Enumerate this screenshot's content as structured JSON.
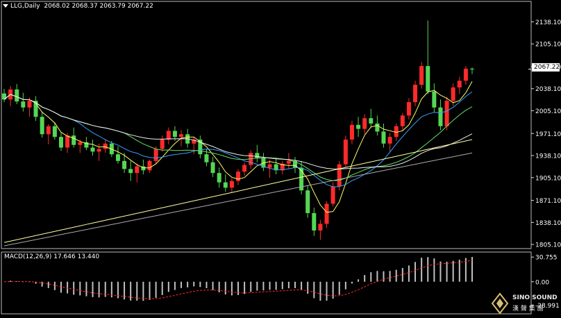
{
  "header": {
    "symbol_label": "LLG,Daily",
    "ohlc": "2068.02 2068.37 2063.79 2067.22"
  },
  "macd_header": {
    "label": "MACD(12,26,9)",
    "values": "17.646 13.440"
  },
  "colors": {
    "background": "#000000",
    "bull": "#ff2a2a",
    "bear": "#55d655",
    "ma_fast": "#ffff66",
    "ma_mid": "#3aa0ff",
    "ma_slow_green": "#66dd66",
    "ma_slow_white": "#f0f0f0",
    "ma_long_yellow": "#ffff99",
    "ma_long_gray": "#aaaaaa",
    "macd_hist": "#c0c0c0",
    "macd_signal": "#ff2a2a"
  },
  "logo": {
    "text_top": "SINO SOUND",
    "text_bottom": "漢 聲 集 團"
  },
  "chart_data": {
    "type": "candlestick",
    "price_axis": {
      "ticks": [
        2138.1,
        2105.1,
        2071.1,
        2038.1,
        2005.1,
        1971.1,
        1938.1,
        1905.1,
        1871.1,
        1838.1,
        1805.1
      ],
      "ylim": [
        1800.0,
        2150.0
      ],
      "current_price": "2067.22"
    },
    "macd_axis": {
      "ticks": [
        "30.755",
        "0.00",
        "-28.991"
      ],
      "ylim": [
        -40.0,
        37.0
      ]
    },
    "candles": [
      [
        2031,
        2038,
        2018,
        2022
      ],
      [
        2022,
        2042,
        2012,
        2037
      ],
      [
        2037,
        2045,
        2015,
        2019
      ],
      [
        2019,
        2032,
        2004,
        2010
      ],
      [
        2010,
        2025,
        1996,
        2020
      ],
      [
        2020,
        2027,
        1990,
        1996
      ],
      [
        1996,
        2004,
        1965,
        1970
      ],
      [
        1970,
        1985,
        1955,
        1982
      ],
      [
        1982,
        1988,
        1962,
        1966
      ],
      [
        1966,
        1972,
        1945,
        1950
      ],
      [
        1950,
        1972,
        1942,
        1968
      ],
      [
        1968,
        1980,
        1950,
        1954
      ],
      [
        1954,
        1962,
        1942,
        1958
      ],
      [
        1958,
        1966,
        1946,
        1950
      ],
      [
        1950,
        1962,
        1938,
        1944
      ],
      [
        1944,
        1956,
        1930,
        1948
      ],
      [
        1948,
        1962,
        1942,
        1956
      ],
      [
        1956,
        1960,
        1936,
        1940
      ],
      [
        1940,
        1952,
        1926,
        1930
      ],
      [
        1930,
        1942,
        1912,
        1918
      ],
      [
        1918,
        1930,
        1900,
        1912
      ],
      [
        1912,
        1926,
        1898,
        1922
      ],
      [
        1922,
        1932,
        1910,
        1916
      ],
      [
        1916,
        1932,
        1912,
        1930
      ],
      [
        1930,
        1952,
        1926,
        1948
      ],
      [
        1948,
        1968,
        1944,
        1962
      ],
      [
        1962,
        1980,
        1955,
        1975
      ],
      [
        1975,
        1982,
        1960,
        1966
      ],
      [
        1966,
        1976,
        1952,
        1970
      ],
      [
        1970,
        1978,
        1950,
        1956
      ],
      [
        1956,
        1966,
        1940,
        1962
      ],
      [
        1962,
        1968,
        1934,
        1940
      ],
      [
        1940,
        1948,
        1922,
        1928
      ],
      [
        1928,
        1936,
        1906,
        1912
      ],
      [
        1912,
        1920,
        1890,
        1898
      ],
      [
        1898,
        1910,
        1884,
        1890
      ],
      [
        1890,
        1904,
        1882,
        1900
      ],
      [
        1900,
        1918,
        1894,
        1914
      ],
      [
        1914,
        1928,
        1908,
        1924
      ],
      [
        1924,
        1946,
        1918,
        1942
      ],
      [
        1942,
        1954,
        1928,
        1934
      ],
      [
        1934,
        1942,
        1915,
        1920
      ],
      [
        1920,
        1932,
        1905,
        1925
      ],
      [
        1925,
        1935,
        1910,
        1916
      ],
      [
        1916,
        1930,
        1910,
        1926
      ],
      [
        1926,
        1942,
        1918,
        1930
      ],
      [
        1930,
        1936,
        1912,
        1920
      ],
      [
        1920,
        1930,
        1880,
        1886
      ],
      [
        1886,
        1894,
        1845,
        1852
      ],
      [
        1852,
        1860,
        1818,
        1826
      ],
      [
        1826,
        1842,
        1812,
        1836
      ],
      [
        1836,
        1870,
        1830,
        1866
      ],
      [
        1866,
        1898,
        1862,
        1892
      ],
      [
        1892,
        1930,
        1886,
        1925
      ],
      [
        1925,
        1968,
        1920,
        1962
      ],
      [
        1962,
        1990,
        1955,
        1984
      ],
      [
        1984,
        1996,
        1966,
        1978
      ],
      [
        1978,
        2000,
        1970,
        1994
      ],
      [
        1994,
        2008,
        1980,
        1986
      ],
      [
        1986,
        1998,
        1968,
        1974
      ],
      [
        1974,
        1986,
        1950,
        1956
      ],
      [
        1956,
        1972,
        1944,
        1966
      ],
      [
        1966,
        1986,
        1960,
        1982
      ],
      [
        1982,
        2002,
        1976,
        1998
      ],
      [
        1998,
        2024,
        1992,
        2018
      ],
      [
        2018,
        2050,
        2012,
        2044
      ],
      [
        2044,
        2078,
        2038,
        2072
      ],
      [
        2072,
        2140,
        2030,
        2034
      ],
      [
        2034,
        2046,
        2002,
        2010
      ],
      [
        2010,
        2022,
        1976,
        1982
      ],
      [
        1982,
        2026,
        1976,
        2020
      ],
      [
        2020,
        2046,
        2012,
        2040
      ],
      [
        2040,
        2056,
        2030,
        2050
      ],
      [
        2050,
        2072,
        2044,
        2068
      ],
      [
        2068,
        2070,
        2060,
        2067
      ]
    ]
  }
}
